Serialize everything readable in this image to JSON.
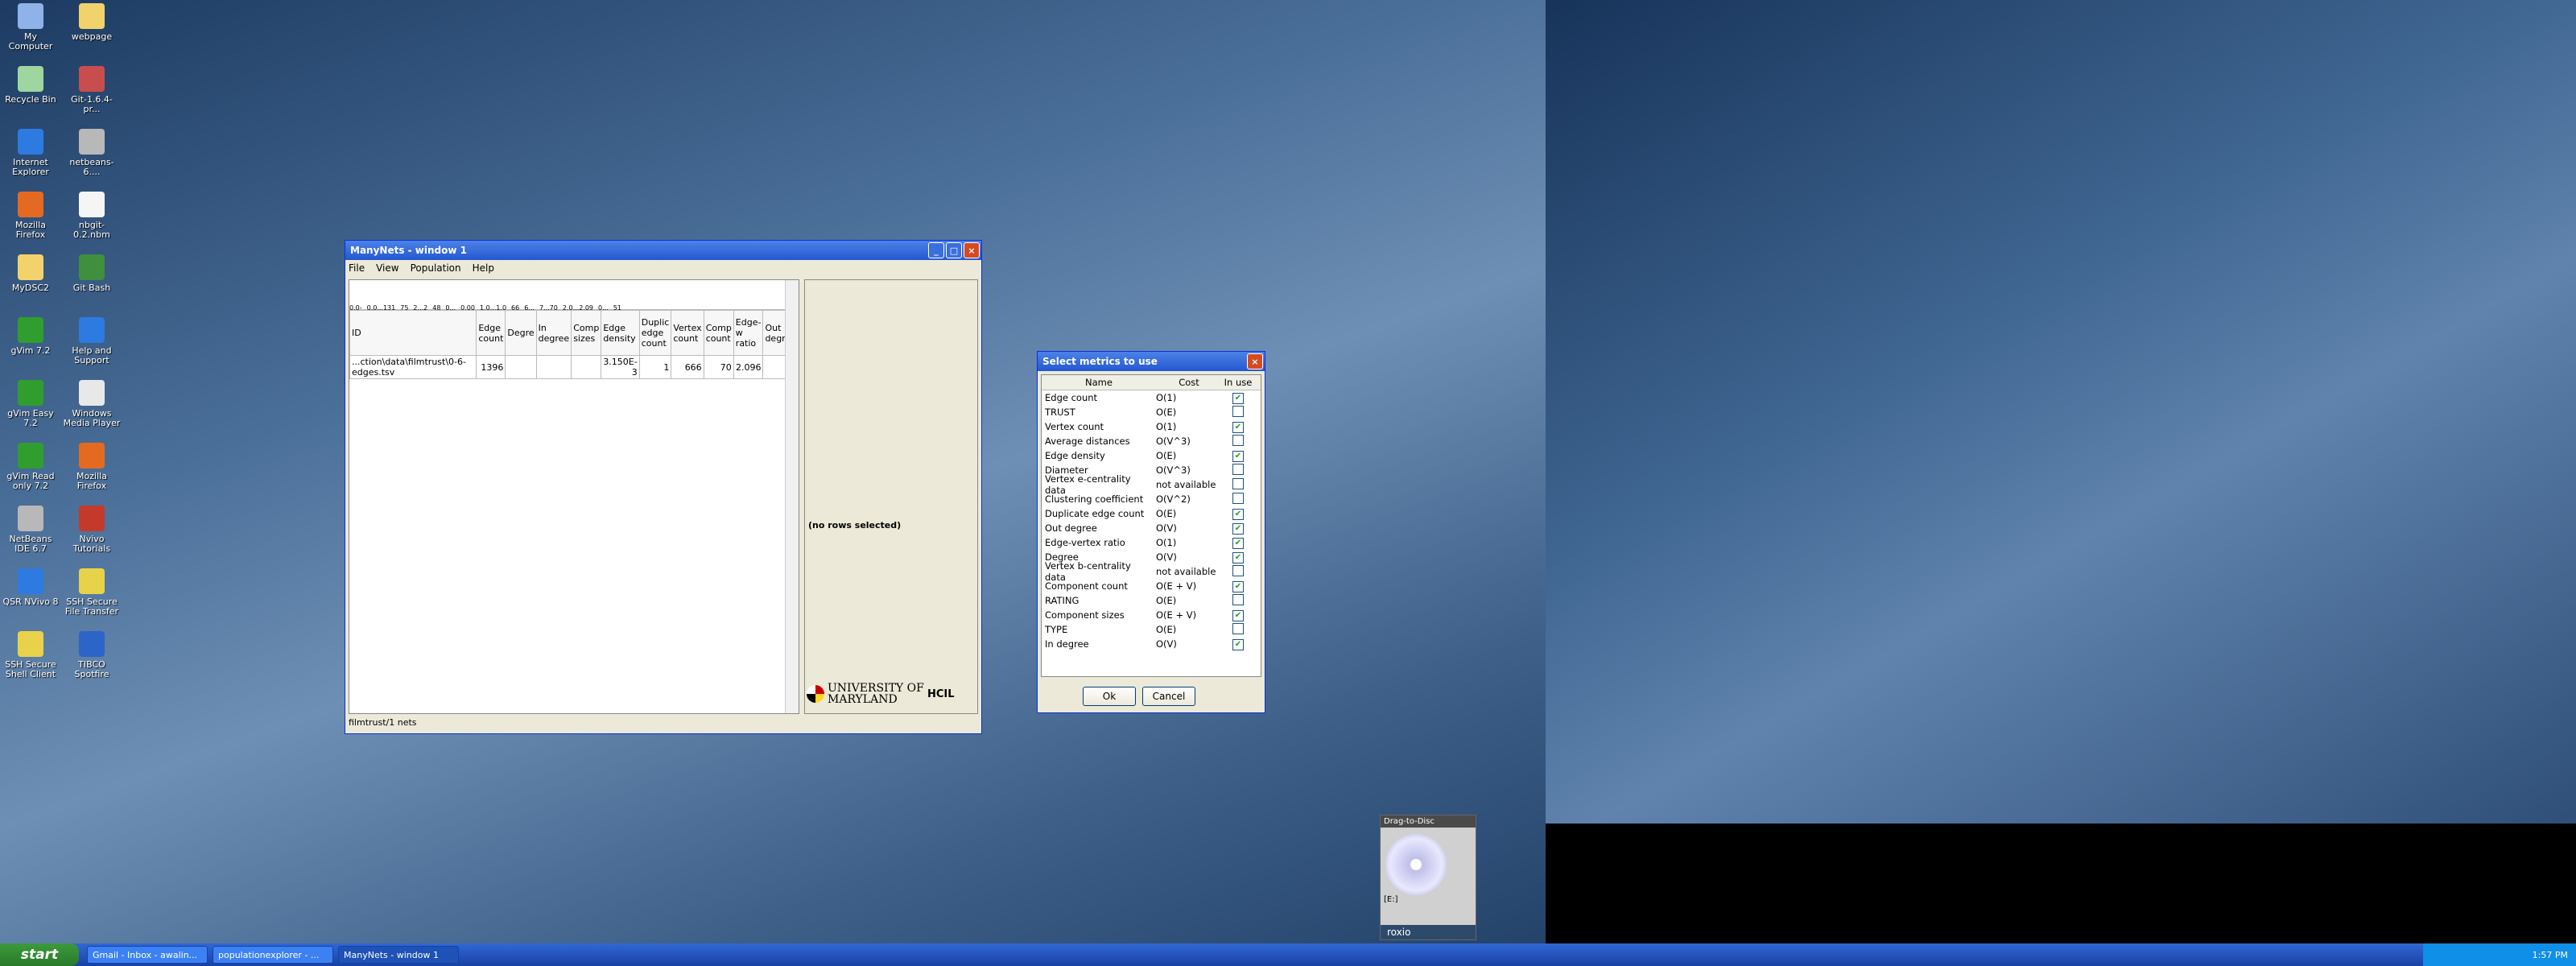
{
  "desktop_icons": [
    {
      "label": "My Computer",
      "icon": "computer-icon",
      "color": "#8fb2e8"
    },
    {
      "label": "webpage",
      "icon": "folder-icon",
      "color": "#f2d36b"
    },
    {
      "label": "Recycle Bin",
      "icon": "recycle-bin-icon",
      "color": "#9fd59f"
    },
    {
      "label": "Git-1.6.4-pr...",
      "icon": "installer-icon",
      "color": "#c84d4d"
    },
    {
      "label": "Internet Explorer",
      "icon": "ie-icon",
      "color": "#2d7be0"
    },
    {
      "label": "netbeans-6....",
      "icon": "netbeans-icon",
      "color": "#b8b8b8"
    },
    {
      "label": "Mozilla Firefox",
      "icon": "firefox-icon",
      "color": "#e46a21"
    },
    {
      "label": "nbgit-0.2.nbm",
      "icon": "file-icon",
      "color": "#f5f5f5"
    },
    {
      "label": "MyDSC2",
      "icon": "folder-icon",
      "color": "#f2d36b"
    },
    {
      "label": "Git Bash",
      "icon": "git-bash-icon",
      "color": "#3f8f3f"
    },
    {
      "label": "gVim 7.2",
      "icon": "vim-icon",
      "color": "#2f9e2f"
    },
    {
      "label": "Help and Support",
      "icon": "help-icon",
      "color": "#2d7be0"
    },
    {
      "label": "gVim Easy 7.2",
      "icon": "vim-icon",
      "color": "#2f9e2f"
    },
    {
      "label": "Windows Media Player",
      "icon": "media-player-icon",
      "color": "#e8e8e8"
    },
    {
      "label": "gVim Read only 7.2",
      "icon": "vim-icon",
      "color": "#2f9e2f"
    },
    {
      "label": "Mozilla Firefox",
      "icon": "firefox-icon",
      "color": "#e46a21"
    },
    {
      "label": "NetBeans IDE 6.7",
      "icon": "netbeans-icon",
      "color": "#b8b8b8"
    },
    {
      "label": "Nvivo Tutorials",
      "icon": "pdf-icon",
      "color": "#c43a2a"
    },
    {
      "label": "QSR NVivo 8",
      "icon": "nvivo-icon",
      "color": "#2d7be0"
    },
    {
      "label": "SSH Secure File Transfer",
      "icon": "ssh-transfer-icon",
      "color": "#e8d24a"
    },
    {
      "label": "SSH Secure Shell Client",
      "icon": "ssh-shell-icon",
      "color": "#e8d24a"
    },
    {
      "label": "TIBCO Spotfire",
      "icon": "spotfire-icon",
      "color": "#2d64c8"
    }
  ],
  "manynets": {
    "title": "ManyNets - window 1",
    "menu": [
      "File",
      "View",
      "Population",
      "Help"
    ],
    "hist_labels": [
      "0.0-",
      "0.0...131",
      "75",
      "2...2",
      "48",
      "0...",
      "0.00",
      "1.0...1.0",
      "66",
      "6...",
      "7...70",
      "2.0...2.09",
      "0...",
      "51"
    ],
    "columns": [
      "ID",
      "Edge count",
      "Degre",
      "In degree",
      "Comp sizes",
      "Edge density",
      "Duplic edge count",
      "Vertex count",
      "Comp count",
      "Edge-w ratio",
      "Out degree"
    ],
    "row": [
      "...ction\\data\\filmtrust\\0-6-edges.tsv",
      "1396",
      "",
      "",
      "",
      "3.150E-3",
      "1",
      "666",
      "70",
      "2.096",
      ""
    ],
    "detail_text": "(no rows selected)",
    "status": "filmtrust/1 nets",
    "logo_text": "UNIVERSITY OF MARYLAND",
    "hcil_text": "HCIL"
  },
  "metrics_dialog": {
    "title": "Select metrics to use",
    "headers": {
      "name": "Name",
      "cost": "Cost",
      "use": "In use"
    },
    "rows": [
      {
        "name": "Edge count",
        "cost": "O(1)",
        "checked": true
      },
      {
        "name": "TRUST",
        "cost": "O(E)",
        "checked": false
      },
      {
        "name": "Vertex count",
        "cost": "O(1)",
        "checked": true
      },
      {
        "name": "Average distances",
        "cost": "O(V^3)",
        "checked": false
      },
      {
        "name": "Edge density",
        "cost": "O(E)",
        "checked": true
      },
      {
        "name": "Diameter",
        "cost": "O(V^3)",
        "checked": false
      },
      {
        "name": "Vertex e-centrality data",
        "cost": "not available",
        "checked": false
      },
      {
        "name": "Clustering coefficient",
        "cost": "O(V^2)",
        "checked": false
      },
      {
        "name": "Duplicate edge count",
        "cost": "O(E)",
        "checked": true
      },
      {
        "name": "Out degree",
        "cost": "O(V)",
        "checked": true
      },
      {
        "name": "Edge-vertex ratio",
        "cost": "O(1)",
        "checked": true
      },
      {
        "name": "Degree",
        "cost": "O(V)",
        "checked": true
      },
      {
        "name": "Vertex b-centrality data",
        "cost": "not available",
        "checked": false
      },
      {
        "name": "Component count",
        "cost": "O(E + V)",
        "checked": true
      },
      {
        "name": "RATING",
        "cost": "O(E)",
        "checked": false
      },
      {
        "name": "Component sizes",
        "cost": "O(E + V)",
        "checked": true
      },
      {
        "name": "TYPE",
        "cost": "O(E)",
        "checked": false
      },
      {
        "name": "In degree",
        "cost": "O(V)",
        "checked": true
      }
    ],
    "ok_label": "Ok",
    "cancel_label": "Cancel"
  },
  "roxio": {
    "title": "Drag-to-Disc",
    "drive": "[E:]",
    "brand": "roxio"
  },
  "taskbar": {
    "start_label": "start",
    "tasks": [
      "Gmail - Inbox - awalin...",
      "populationexplorer - ...",
      "ManyNets - window 1"
    ],
    "clock": "1:57 PM"
  },
  "colors": {
    "xp_blue": "#2458d0",
    "close_red": "#d64a22",
    "check_green": "#21a121"
  }
}
